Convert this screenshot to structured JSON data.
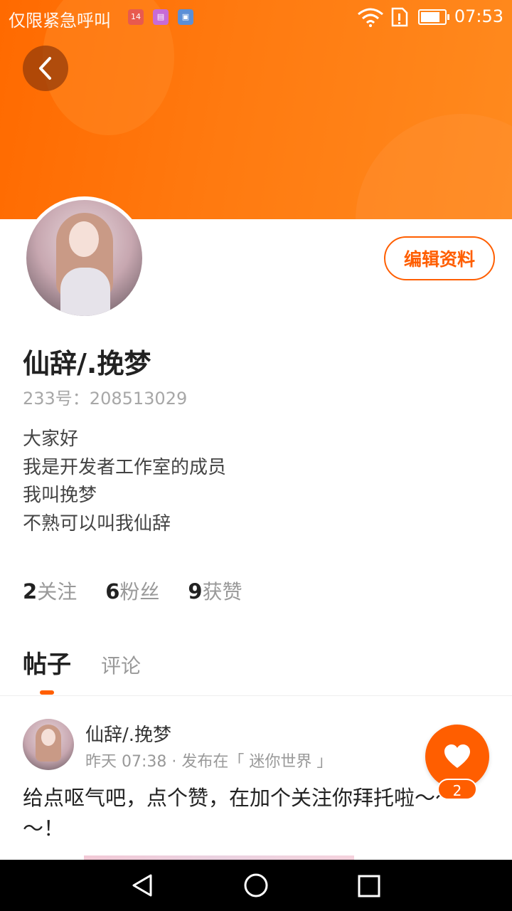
{
  "status_bar": {
    "carrier_text": "仅限紧急呼叫",
    "calendar_badge": "14",
    "time": "07:53"
  },
  "profile": {
    "edit_button": "编辑资料",
    "username": "仙辞/.挽梦",
    "user_id": "233号：208513029",
    "bio": [
      "大家好",
      "我是开发者工作室的成员",
      "我叫挽梦",
      "不熟可以叫我仙辞"
    ],
    "stats": [
      {
        "value": "2",
        "label": "关注"
      },
      {
        "value": "6",
        "label": "粉丝"
      },
      {
        "value": "9",
        "label": "获赞"
      }
    ]
  },
  "tabs": [
    {
      "label": "帖子",
      "active": true
    },
    {
      "label": "评论",
      "active": false
    }
  ],
  "post": {
    "author": "仙辞/.挽梦",
    "meta": "昨天 07:38 · 发布在「 迷你世界 」",
    "text": "给点呕气吧，点个赞，在加个关注你拜托啦～～～！",
    "like_count": "2"
  },
  "colors": {
    "accent": "#ff5e00",
    "header": "#ff7a10"
  },
  "icons": {
    "back": "chevron-left-icon",
    "like": "heart-icon",
    "wifi": "wifi-icon",
    "battery": "battery-icon"
  }
}
